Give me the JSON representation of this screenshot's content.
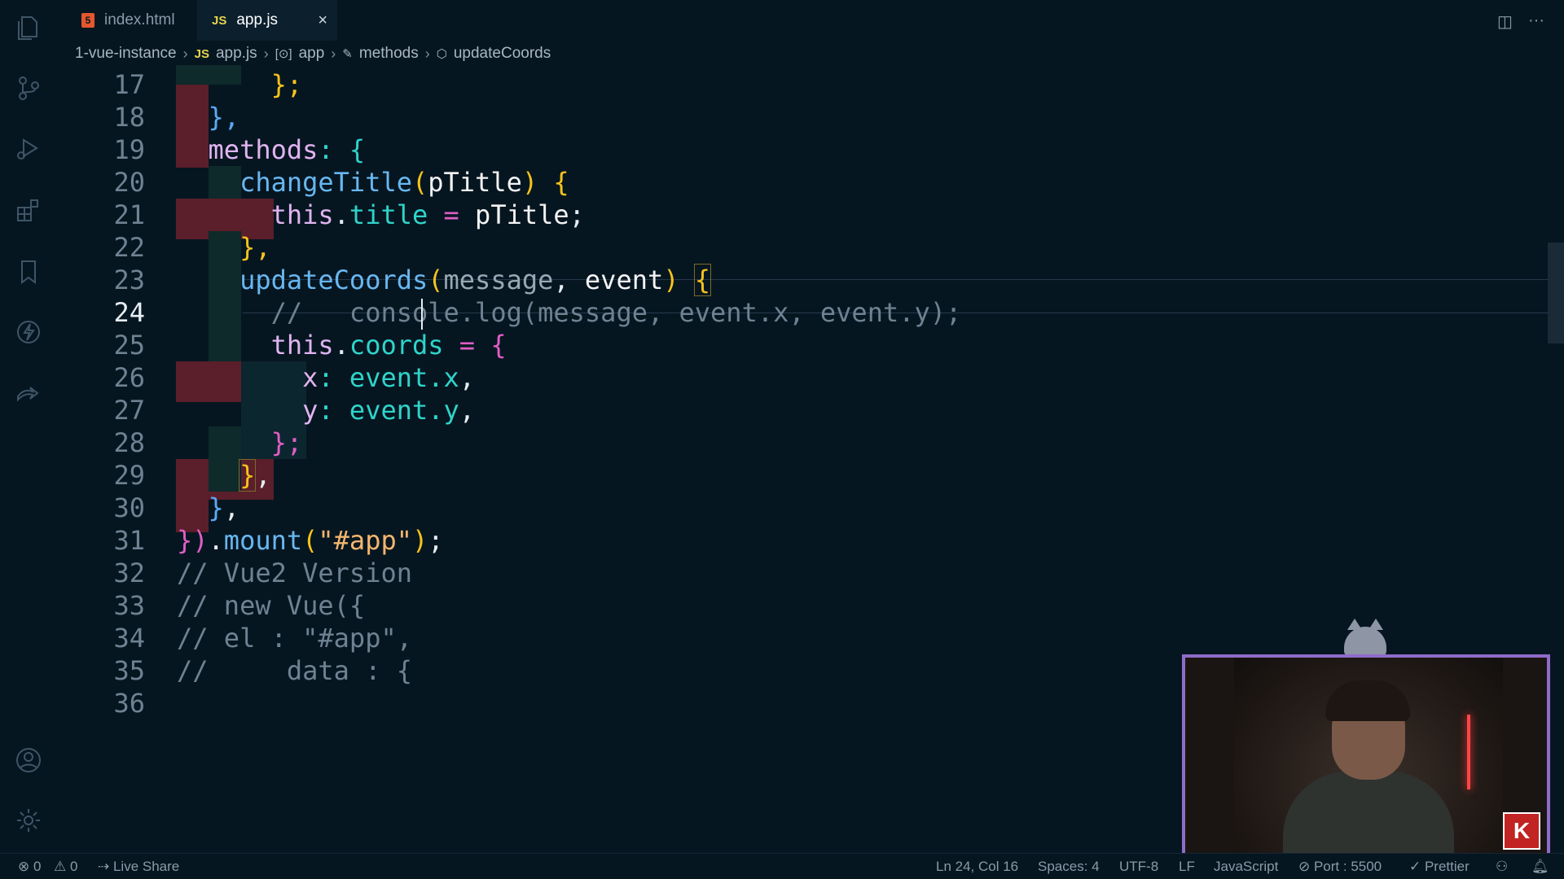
{
  "tabs": [
    {
      "label": "index.html",
      "icon": "html5-icon",
      "active": false
    },
    {
      "label": "app.js",
      "icon": "js-file-icon",
      "active": true
    }
  ],
  "tab_icons": {
    "html": "5",
    "js": "JS",
    "close": "×",
    "split": "◫",
    "more": "···"
  },
  "breadcrumb": [
    {
      "label": "1-vue-instance",
      "icon": ""
    },
    {
      "label": "app.js",
      "icon": "JS"
    },
    {
      "label": "app",
      "icon": "[⊙]"
    },
    {
      "label": "methods",
      "icon": "✎"
    },
    {
      "label": "updateCoords",
      "icon": "⬡"
    }
  ],
  "editor": {
    "current_line": 24,
    "lines": [
      {
        "n": "17"
      },
      {
        "n": "18"
      },
      {
        "n": "19"
      },
      {
        "n": "20"
      },
      {
        "n": "21"
      },
      {
        "n": "22"
      },
      {
        "n": "23"
      },
      {
        "n": "24"
      },
      {
        "n": "25"
      },
      {
        "n": "26"
      },
      {
        "n": "27"
      },
      {
        "n": "28"
      },
      {
        "n": "29"
      },
      {
        "n": "30"
      },
      {
        "n": "31"
      },
      {
        "n": "32"
      },
      {
        "n": "33"
      },
      {
        "n": "34"
      },
      {
        "n": "35"
      },
      {
        "n": "36"
      }
    ],
    "code": {
      "l17": "};",
      "l18": "},",
      "l19_key": "methods",
      "l19_rest": ": {",
      "l20_fn": "changeTitle",
      "l20_open": "(",
      "l20_param": "pTitle",
      "l20_close": ")",
      "l20_brace": "{",
      "l21_this": "this",
      "l21_dot": ".",
      "l21_prop": "title",
      "l21_op": " = ",
      "l21_val": "pTitle",
      "l21_end": ";",
      "l22": "},",
      "l23_fn": "updateCoords",
      "l23_open": "(",
      "l23_p1": "message",
      "l23_comma": ", ",
      "l23_p2": "event",
      "l23_close": ")",
      "l23_brace": "{",
      "l24": "//   console.log(message, event.x, event.y);",
      "l25_this": "this",
      "l25_dot": ".",
      "l25_prop": "coords",
      "l25_op": " = ",
      "l25_brace": "{",
      "l26_key": "x",
      "l26_colon": ": ",
      "l26_val": "event.x",
      "l26_comma": ",",
      "l27_key": "y",
      "l27_colon": ": ",
      "l27_val": "event.y",
      "l27_comma": ",",
      "l28": "};",
      "l29_brace": "}",
      "l29_comma": ",",
      "l30_brace": "}",
      "l30_comma": ",",
      "l31_b1": "}",
      "l31_b2": ")",
      "l31_dot": ".",
      "l31_fn": "mount",
      "l31_open": "(",
      "l31_str": "\"#app\"",
      "l31_close": ")",
      "l31_end": ";",
      "l32": "// Vue2 Version",
      "l33": "// new Vue({",
      "l34": "// el : \"#app\",",
      "l35": "//     data : {"
    }
  },
  "statusbar": {
    "errors": "⊗ 0",
    "warnings": "⚠ 0",
    "live_share": "Live Share",
    "position": "Ln 24, Col 16",
    "spaces": "Spaces: 4",
    "encoding": "UTF-8",
    "eol": "LF",
    "language": "JavaScript",
    "port": "Port : 5500",
    "formatter": "Prettier"
  },
  "webcam": {
    "logo": "K"
  },
  "colors": {
    "background": "#061621",
    "comment": "#6e8292",
    "function": "#68b7f0",
    "bracket_gold": "#f7c31b",
    "bracket_magenta": "#e05ec5",
    "property": "#2fd4c9",
    "indent_error": "#5a1f2a",
    "webcam_border": "#8f6cc9"
  }
}
